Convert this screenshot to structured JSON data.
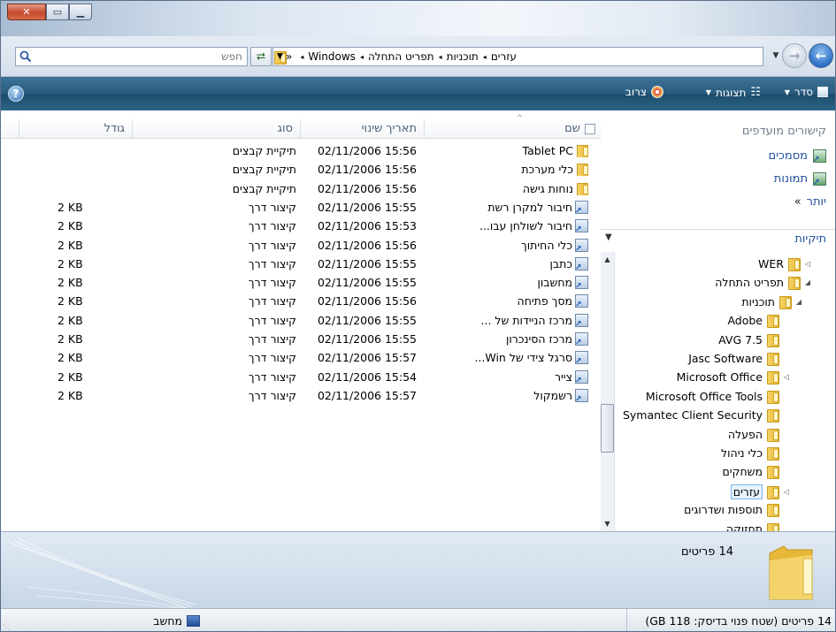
{
  "address": {
    "crumbs": [
      "Windows",
      "תפריט התחלה",
      "תוכניות",
      "עזרים"
    ],
    "overflow": "«",
    "search_placeholder": "חפש"
  },
  "commandbar": {
    "organize": "סדר",
    "views": "תצוגות",
    "burn": "צרוב"
  },
  "navpane": {
    "favorites_title": "קישורים מועדפים",
    "favorites": [
      "מסמכים",
      "תמונות"
    ],
    "more": "יותר",
    "folders_title": "תיקיות",
    "tree": [
      {
        "label": "WER",
        "toggle": "◁",
        "level": 0
      },
      {
        "label": "תפריט התחלה",
        "toggle": "◢",
        "level": 0
      },
      {
        "label": "תוכניות",
        "toggle": "◢",
        "level": 1
      },
      {
        "label": "Adobe",
        "toggle": "",
        "level": 2
      },
      {
        "label": "AVG 7.5",
        "toggle": "",
        "level": 2
      },
      {
        "label": "Jasc Software",
        "toggle": "",
        "level": 2
      },
      {
        "label": "Microsoft Office",
        "toggle": "◁",
        "level": 2
      },
      {
        "label": "Microsoft Office Tools",
        "toggle": "",
        "level": 2
      },
      {
        "label": "Symantec Client Security",
        "toggle": "",
        "level": 2
      },
      {
        "label": "הפעלה",
        "toggle": "",
        "level": 2
      },
      {
        "label": "כלי ניהול",
        "toggle": "",
        "level": 2
      },
      {
        "label": "משחקים",
        "toggle": "",
        "level": 2
      },
      {
        "label": "עזרים",
        "toggle": "◁",
        "level": 2,
        "selected": true
      },
      {
        "label": "תוספות ושדרוגים",
        "toggle": "",
        "level": 2
      },
      {
        "label": "תחזוקה",
        "toggle": "",
        "level": 2
      }
    ]
  },
  "filelist": {
    "columns": {
      "name": "שם",
      "date": "תאריך שינוי",
      "type": "סוג",
      "size": "גודל"
    },
    "rows": [
      {
        "name": "Tablet PC",
        "date": "02/11/2006 15:56",
        "type": "תיקיית קבצים",
        "size": "",
        "kind": "folder"
      },
      {
        "name": "כלי מערכת",
        "date": "02/11/2006 15:56",
        "type": "תיקיית קבצים",
        "size": "",
        "kind": "folder"
      },
      {
        "name": "נוחות גישה",
        "date": "02/11/2006 15:56",
        "type": "תיקיית קבצים",
        "size": "",
        "kind": "folder"
      },
      {
        "name": "חיבור למקרן רשת",
        "date": "02/11/2006 15:55",
        "type": "קיצור דרך",
        "size": "2 KB",
        "kind": "link"
      },
      {
        "name": "חיבור לשולחן עבו...",
        "date": "02/11/2006 15:53",
        "type": "קיצור דרך",
        "size": "2 KB",
        "kind": "link"
      },
      {
        "name": "כלי החיתוך",
        "date": "02/11/2006 15:56",
        "type": "קיצור דרך",
        "size": "2 KB",
        "kind": "link"
      },
      {
        "name": "כתבן",
        "date": "02/11/2006 15:55",
        "type": "קיצור דרך",
        "size": "2 KB",
        "kind": "link"
      },
      {
        "name": "מחשבון",
        "date": "02/11/2006 15:55",
        "type": "קיצור דרך",
        "size": "2 KB",
        "kind": "link"
      },
      {
        "name": "מסך פתיחה",
        "date": "02/11/2006 15:56",
        "type": "קיצור דרך",
        "size": "2 KB",
        "kind": "link"
      },
      {
        "name": "מרכז הניידות של ...",
        "date": "02/11/2006 15:55",
        "type": "קיצור דרך",
        "size": "2 KB",
        "kind": "link"
      },
      {
        "name": "מרכז הסינכרון",
        "date": "02/11/2006 15:55",
        "type": "קיצור דרך",
        "size": "2 KB",
        "kind": "link"
      },
      {
        "name": "סרגל צידי של Win...",
        "date": "02/11/2006 15:57",
        "type": "קיצור דרך",
        "size": "2 KB",
        "kind": "link"
      },
      {
        "name": "צייר",
        "date": "02/11/2006 15:54",
        "type": "קיצור דרך",
        "size": "2 KB",
        "kind": "link"
      },
      {
        "name": "רשמקול",
        "date": "02/11/2006 15:57",
        "type": "קיצור דרך",
        "size": "2 KB",
        "kind": "link"
      }
    ]
  },
  "details": {
    "count": "14 פריטים"
  },
  "status": {
    "left": "14 פריטים (שטח פנוי בדיסק: 118 GB)",
    "computer": "מחשב"
  }
}
